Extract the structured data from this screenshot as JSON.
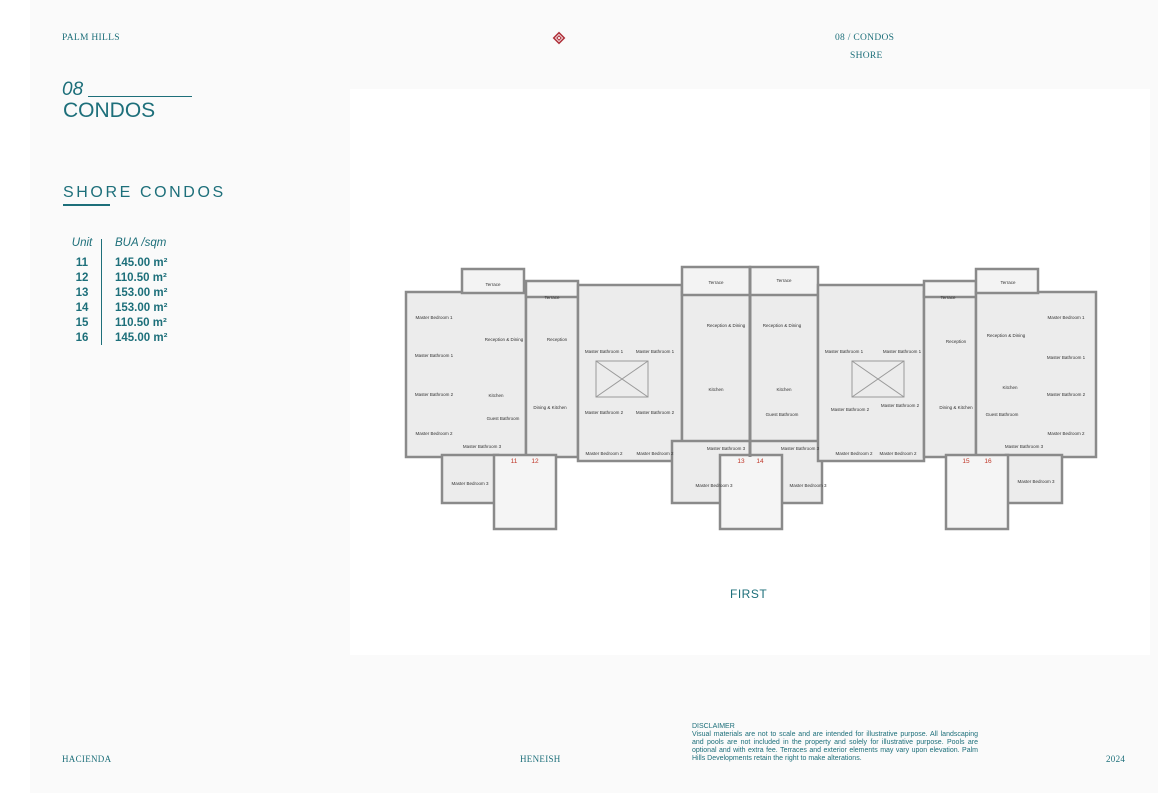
{
  "header": {
    "brand": "PALM HILLS",
    "section": "08 / CONDOS",
    "subsection": "SHORE"
  },
  "section_number": "08",
  "title": "CONDOS",
  "subtitle": "SHORE CONDOS",
  "unit_table": {
    "headers": [
      "Unit",
      "BUA /sqm"
    ],
    "rows": [
      {
        "unit": "11",
        "bua": "145.00 m²"
      },
      {
        "unit": "12",
        "bua": "110.50 m²"
      },
      {
        "unit": "13",
        "bua": "153.00 m²"
      },
      {
        "unit": "14",
        "bua": "153.00 m²"
      },
      {
        "unit": "15",
        "bua": "110.50 m²"
      },
      {
        "unit": "16",
        "bua": "145.00 m²"
      }
    ]
  },
  "floor_plan": {
    "floor_label": "FIRST",
    "room_labels": {
      "terrace": "Terrace",
      "master_bedroom_1": "Master Bedroom 1",
      "master_bedroom_2": "Master Bedroom 2",
      "master_bedroom_3": "Master Bedroom 3",
      "master_bathroom_1": "Master Bathroom 1",
      "master_bathroom_2": "Master Bathroom 2",
      "master_bathroom_3": "Master Bathroom 3",
      "reception_dining": "Reception & Dining",
      "reception": "Reception",
      "kitchen": "Kitchen",
      "dining_kitchen": "Dining & Kitchen",
      "guest_bathroom": "Guest Bathroom"
    },
    "unit_numbers": [
      "11",
      "12",
      "13",
      "14",
      "15",
      "16"
    ]
  },
  "disclaimer": {
    "title": "DISCLAIMER",
    "text": "Visual materials are not to scale and are intended for illustrative purpose. All landscaping and pools are not included in the property and solely for illustrative purpose. Pools are optional and with extra fee. Terraces and exterior elements may vary upon elevation. Palm Hills Developments retain the right to make alterations."
  },
  "footer": {
    "left": "HACIENDA",
    "center": "HENEISH",
    "right": "2024"
  },
  "colors": {
    "primary": "#1d6f7a",
    "logo": "#b0323c",
    "unit_number": "#c0392b",
    "wall": "#8a8a8a",
    "floor": "#e9e9e9"
  }
}
